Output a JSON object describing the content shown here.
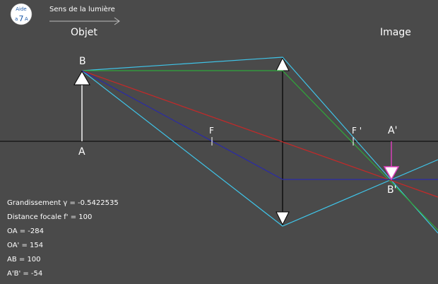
{
  "logo": {
    "line1": "Aide",
    "line2": "a",
    "glyph": "7",
    "line3": "A"
  },
  "direction": {
    "label": "Sens de la lumière"
  },
  "headers": {
    "object": "Objet",
    "image": "Image"
  },
  "points": {
    "B": "B",
    "A": "A",
    "F": "F",
    "F_prime": "F '",
    "A_prime": "A'",
    "B_prime": "B'"
  },
  "readouts": [
    "Grandissement γ = -0.5422535",
    "Distance focale f' = 100",
    "OA = -284",
    "OA' = 154",
    "AB = 100",
    "A'B' = -54"
  ],
  "optics": {
    "lens_type": "convergent",
    "focal_length": 100,
    "OA": -284,
    "OA_prime": 154,
    "AB": 100,
    "A_prime_B_prime": -54,
    "magnification": -0.5422535
  },
  "colors": {
    "background": "#4a4a4a",
    "axis": "#000000",
    "ray_cyan": "#3fc4e8",
    "ray_green": "#2fa83a",
    "ray_red": "#c02a2a",
    "ray_blue": "#2a2aa8",
    "image_arrow": "#e040c0",
    "object_arrow": "#ffffff"
  }
}
